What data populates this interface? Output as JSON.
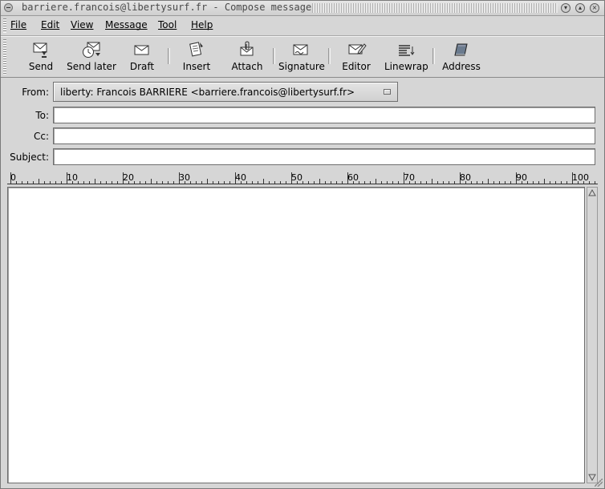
{
  "window": {
    "title": "barriere.francois@libertysurf.fr - Compose message"
  },
  "menubar": {
    "items": [
      "File",
      "Edit",
      "View",
      "Message",
      "Tool",
      "Help"
    ]
  },
  "toolbar": {
    "items": [
      {
        "label": "Send",
        "icon": "send-icon"
      },
      {
        "label": "Send later",
        "icon": "send-later-icon"
      },
      {
        "label": "Draft",
        "icon": "draft-icon"
      },
      {
        "label": "Insert",
        "icon": "insert-icon"
      },
      {
        "label": "Attach",
        "icon": "attach-icon"
      },
      {
        "label": "Signature",
        "icon": "signature-icon"
      },
      {
        "label": "Editor",
        "icon": "editor-icon"
      },
      {
        "label": "Linewrap",
        "icon": "linewrap-icon"
      },
      {
        "label": "Address",
        "icon": "address-book-icon"
      }
    ]
  },
  "header": {
    "from_label": "From:",
    "from_value": "liberty: Francois BARRIERE <barriere.francois@libertysurf.fr>",
    "to_label": "To:",
    "to_value": "",
    "cc_label": "Cc:",
    "cc_value": "",
    "subject_label": "Subject:",
    "subject_value": ""
  },
  "ruler": {
    "labels": [
      "0",
      "10",
      "20",
      "30",
      "40",
      "50",
      "60",
      "70",
      "80",
      "90",
      "100"
    ]
  },
  "body": {
    "text": ""
  }
}
